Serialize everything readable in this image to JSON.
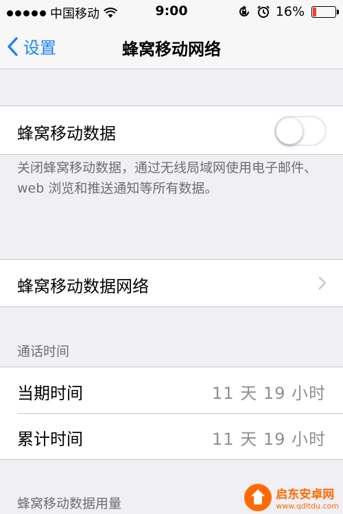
{
  "status_bar": {
    "carrier": "中国移动",
    "time": "9:00",
    "battery_percent": "16%",
    "battery_level": 0.16,
    "signal_bars": 5,
    "icons": [
      "wifi-icon",
      "rotation-lock-icon",
      "alarm-icon",
      "battery-icon"
    ]
  },
  "nav": {
    "back_label": "设置",
    "title": "蜂窝移动网络"
  },
  "cellular_data": {
    "label": "蜂窝移动数据",
    "enabled": false,
    "footnote": "关闭蜂窝移动数据，通过无线局域网使用电子邮件、web 浏览和推送通知等所有数据。"
  },
  "cellular_network": {
    "label": "蜂窝移动数据网络"
  },
  "call_time": {
    "header": "通话时间",
    "rows": [
      {
        "label": "当期时间",
        "value": "11 天 19 小时"
      },
      {
        "label": "累计时间",
        "value": "11 天 19 小时"
      }
    ]
  },
  "usage": {
    "header": "蜂窝移动数据用量"
  },
  "watermark": {
    "name": "启东安卓网",
    "url": "www.qdltdu.com"
  },
  "colors": {
    "accent": "#1a82fb",
    "background": "#efeff4",
    "secondary_text": "#6d6d72",
    "battery_low": "#ff3b30"
  }
}
